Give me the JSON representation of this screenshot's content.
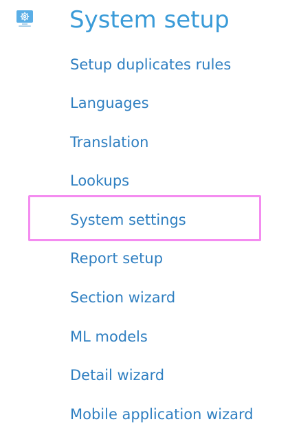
{
  "section": {
    "icon": "gear-monitor-icon",
    "title": "System setup"
  },
  "menu": {
    "items": [
      {
        "label": "Setup duplicates rules"
      },
      {
        "label": "Languages"
      },
      {
        "label": "Translation"
      },
      {
        "label": "Lookups"
      },
      {
        "label": "System settings",
        "highlighted": true
      },
      {
        "label": "Report setup"
      },
      {
        "label": "Section wizard"
      },
      {
        "label": "ML models"
      },
      {
        "label": "Detail wizard"
      },
      {
        "label": "Mobile application wizard"
      }
    ]
  },
  "colors": {
    "title": "#3a9bd8",
    "link": "#2f7fc1",
    "highlight": "#f48cf0",
    "icon_bg": "#5aaee6"
  }
}
